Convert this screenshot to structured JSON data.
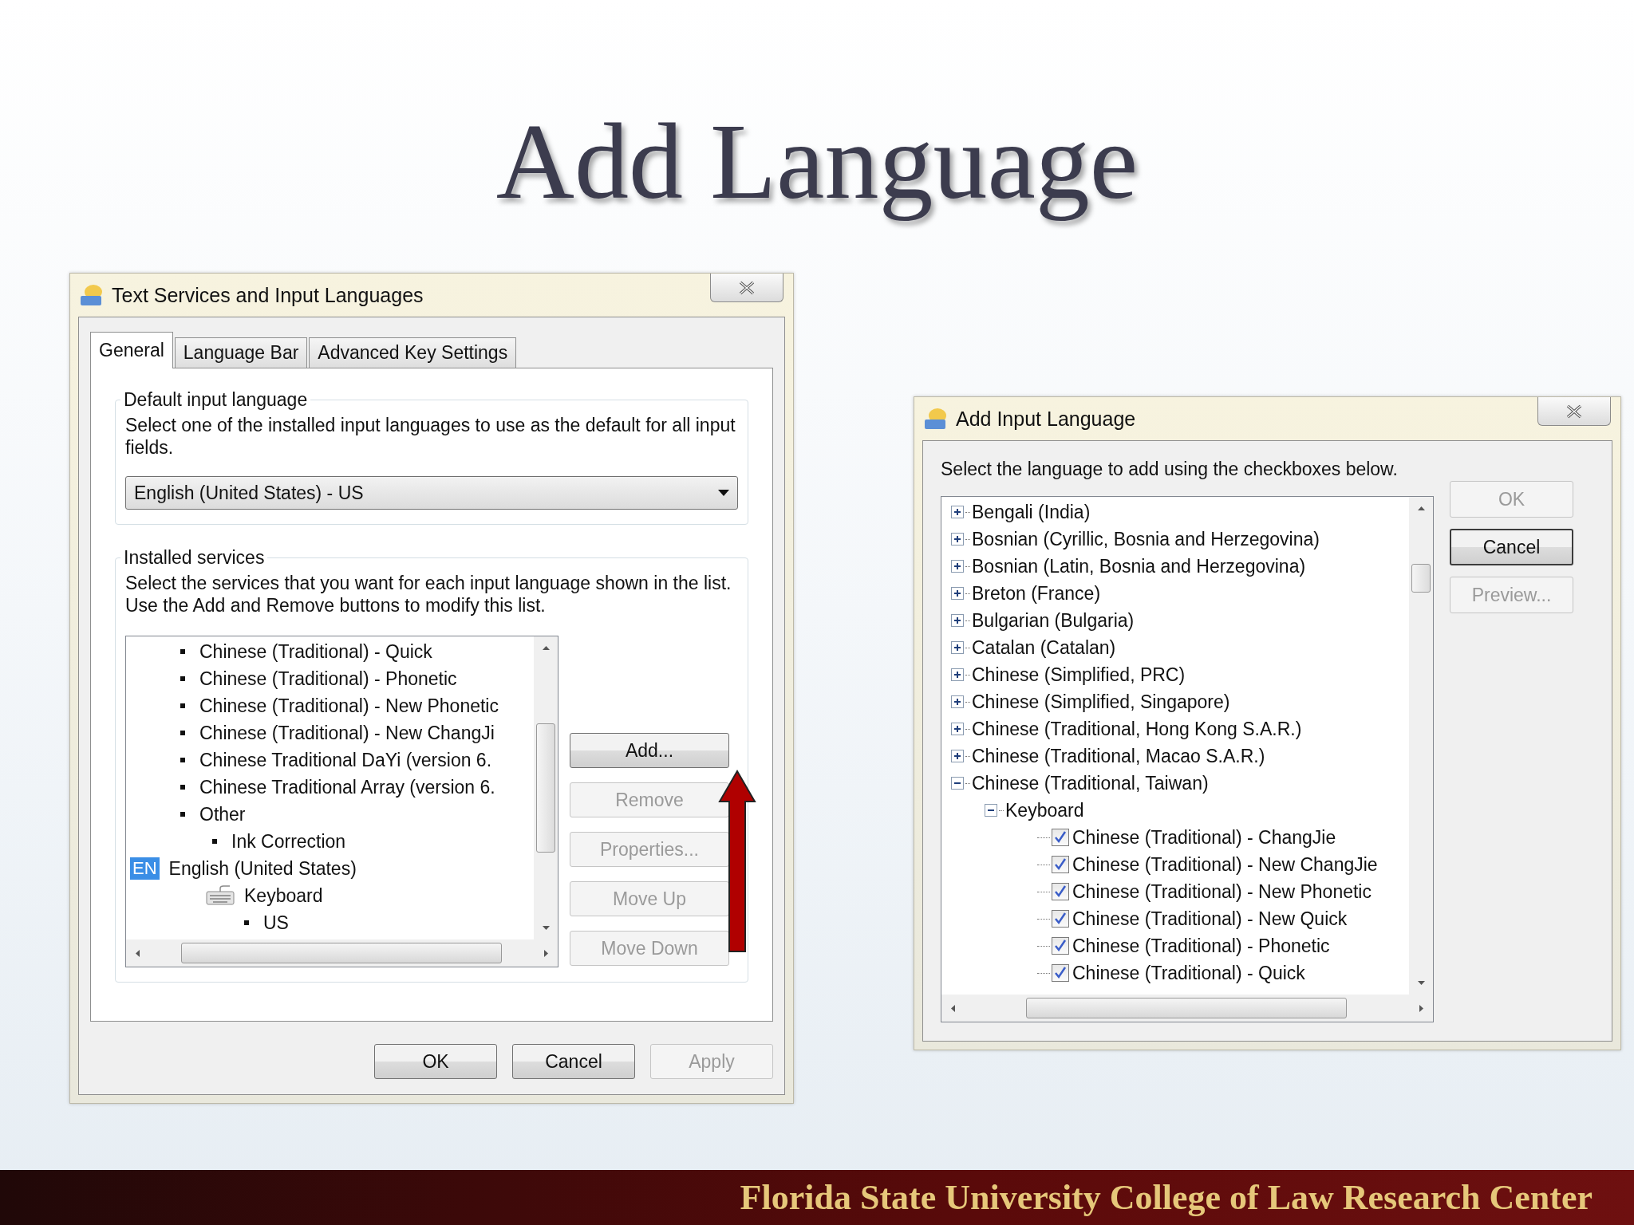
{
  "slide": {
    "title": "Add Language",
    "footer": "Florida State University College of Law Research Center"
  },
  "text_services_dialog": {
    "title": "Text Services and Input Languages",
    "tabs": [
      {
        "label": "General",
        "selected": true
      },
      {
        "label": "Language Bar",
        "selected": false
      },
      {
        "label": "Advanced Key Settings",
        "selected": false
      }
    ],
    "default_group": {
      "label": "Default input language",
      "description": "Select one of the installed input languages to use as the default for all input fields.",
      "dropdown_value": "English (United States) - US"
    },
    "services_group": {
      "label": "Installed services",
      "description": "Select the services that you want for each input language shown in the list. Use the Add and Remove buttons to modify this list.",
      "tree": [
        {
          "label": "Chinese (Traditional) - Quick",
          "kind": "service"
        },
        {
          "label": "Chinese (Traditional) - Phonetic",
          "kind": "service"
        },
        {
          "label": "Chinese (Traditional) - New Phonetic",
          "kind": "service"
        },
        {
          "label": "Chinese (Traditional) - New ChangJi",
          "kind": "service"
        },
        {
          "label": "Chinese Traditional DaYi (version 6.",
          "kind": "service"
        },
        {
          "label": "Chinese Traditional Array (version 6.",
          "kind": "service"
        },
        {
          "label": "Other",
          "kind": "service",
          "children": [
            {
              "label": "Ink Correction",
              "kind": "service"
            }
          ]
        },
        {
          "label": "English (United States)",
          "kind": "language",
          "badge": "EN",
          "children": [
            {
              "label": "Keyboard",
              "kind": "keyboard",
              "children": [
                {
                  "label": "US",
                  "kind": "service"
                }
              ]
            }
          ]
        }
      ],
      "buttons": [
        {
          "label": "Add...",
          "disabled": false
        },
        {
          "label": "Remove",
          "disabled": true
        },
        {
          "label": "Properties...",
          "disabled": true
        },
        {
          "label": "Move Up",
          "disabled": true
        },
        {
          "label": "Move Down",
          "disabled": true
        }
      ]
    },
    "buttons": [
      {
        "label": "OK",
        "disabled": false
      },
      {
        "label": "Cancel",
        "disabled": false
      },
      {
        "label": "Apply",
        "disabled": true
      }
    ]
  },
  "add_input_dialog": {
    "title": "Add Input Language",
    "instruction": "Select the language to add using the checkboxes below.",
    "tree": [
      {
        "label": "Bengali (India)",
        "kind": "expander",
        "expanded": false
      },
      {
        "label": "Bosnian (Cyrillic, Bosnia and Herzegovina)",
        "kind": "expander",
        "expanded": false
      },
      {
        "label": "Bosnian (Latin, Bosnia and Herzegovina)",
        "kind": "expander",
        "expanded": false
      },
      {
        "label": "Breton (France)",
        "kind": "expander",
        "expanded": false
      },
      {
        "label": "Bulgarian (Bulgaria)",
        "kind": "expander",
        "expanded": false
      },
      {
        "label": "Catalan (Catalan)",
        "kind": "expander",
        "expanded": false
      },
      {
        "label": "Chinese (Simplified, PRC)",
        "kind": "expander",
        "expanded": false
      },
      {
        "label": "Chinese (Simplified, Singapore)",
        "kind": "expander",
        "expanded": false
      },
      {
        "label": "Chinese (Traditional, Hong Kong S.A.R.)",
        "kind": "expander",
        "expanded": false
      },
      {
        "label": "Chinese (Traditional, Macao S.A.R.)",
        "kind": "expander",
        "expanded": false
      },
      {
        "label": "Chinese (Traditional, Taiwan)",
        "kind": "expander",
        "expanded": true,
        "children": [
          {
            "label": "Keyboard",
            "kind": "expander",
            "expanded": true,
            "children": [
              {
                "label": "Chinese (Traditional) - ChangJie",
                "kind": "checkbox",
                "checked": true
              },
              {
                "label": "Chinese (Traditional) - New ChangJie",
                "kind": "checkbox",
                "checked": true
              },
              {
                "label": "Chinese (Traditional) - New Phonetic",
                "kind": "checkbox",
                "checked": true
              },
              {
                "label": "Chinese (Traditional) - New Quick",
                "kind": "checkbox",
                "checked": true
              },
              {
                "label": "Chinese (Traditional) - Phonetic",
                "kind": "checkbox",
                "checked": true
              },
              {
                "label": "Chinese (Traditional) - Quick",
                "kind": "checkbox",
                "checked": true
              }
            ]
          }
        ]
      }
    ],
    "buttons": [
      {
        "label": "OK",
        "disabled": true,
        "default": false
      },
      {
        "label": "Cancel",
        "disabled": false,
        "default": true
      },
      {
        "label": "Preview...",
        "disabled": true,
        "default": false
      }
    ]
  }
}
